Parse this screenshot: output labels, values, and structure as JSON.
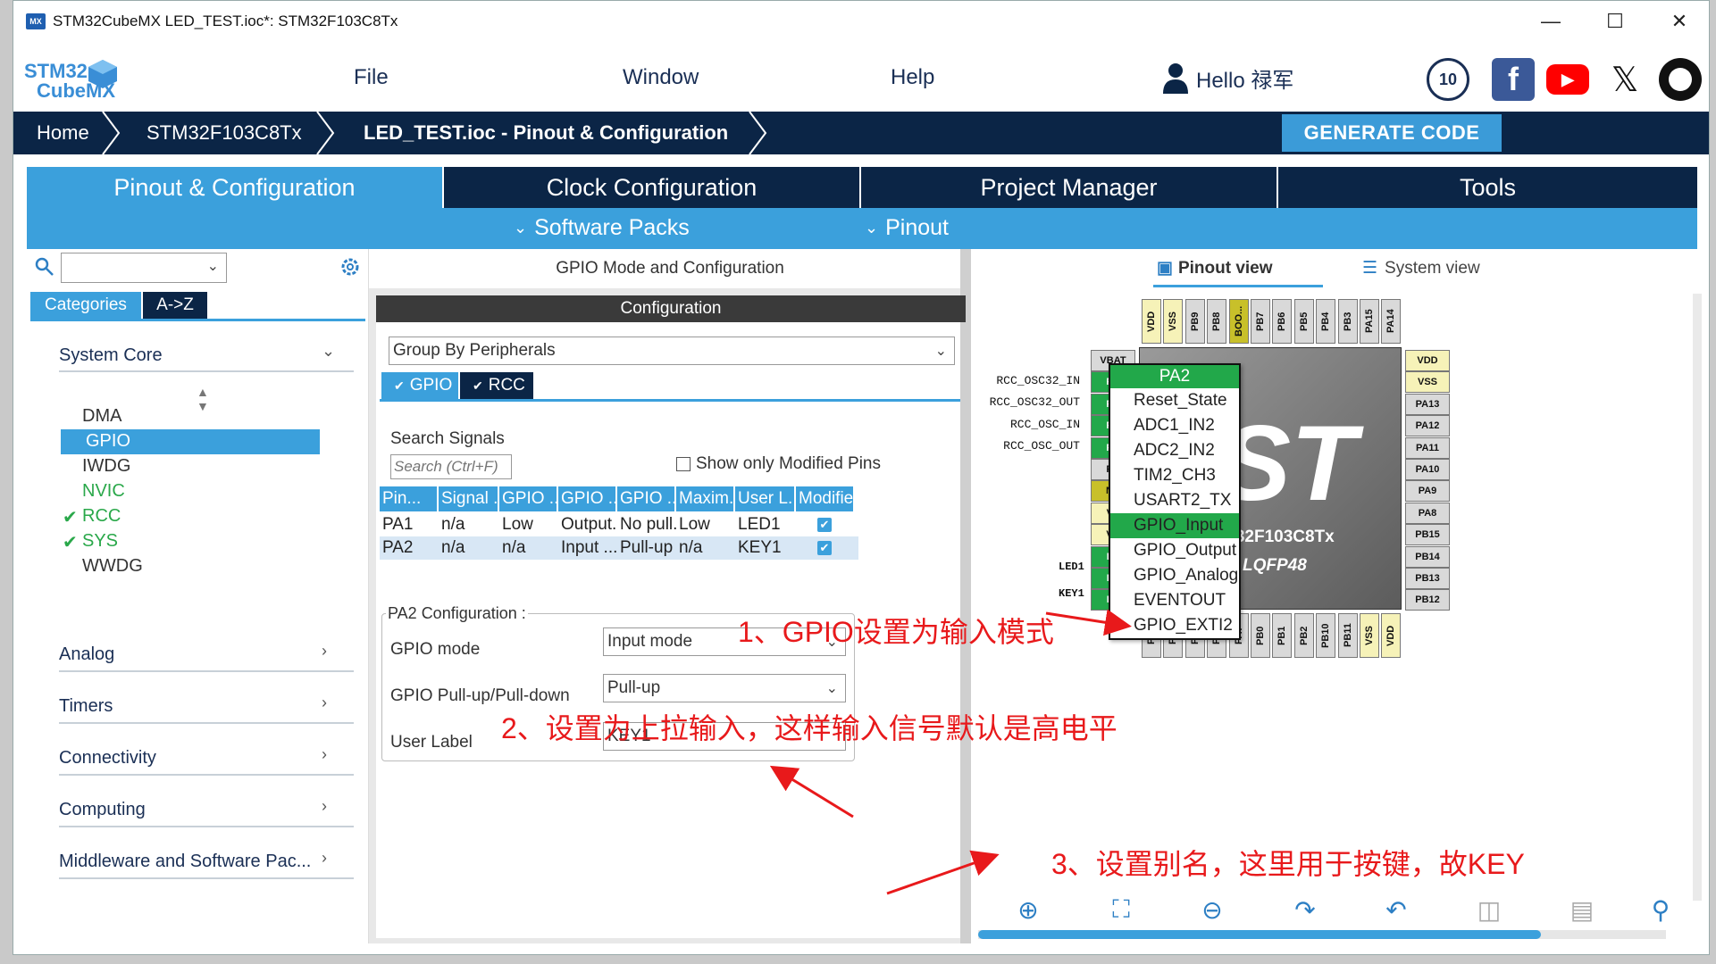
{
  "window": {
    "title": "STM32CubeMX LED_TEST.ioc*: STM32F103C8Tx",
    "app_icon": "MX"
  },
  "logo": {
    "line1": "STM32",
    "line2": "CubeMX"
  },
  "menu": {
    "file": "File",
    "window": "Window",
    "help": "Help"
  },
  "user": {
    "greeting": "Hello 禄军"
  },
  "social": {
    "badge": "10"
  },
  "breadcrumb": {
    "home": "Home",
    "mcu": "STM32F103C8Tx",
    "page": "LED_TEST.ioc - Pinout & Configuration"
  },
  "generate_label": "GENERATE CODE",
  "tabs": [
    "Pinout & Configuration",
    "Clock Configuration",
    "Project Manager",
    "Tools"
  ],
  "subtabs": {
    "software_packs": "Software Packs",
    "pinout": "Pinout"
  },
  "left": {
    "cat_tab": "Categories",
    "az_tab": "A->Z",
    "system_core": "System Core",
    "core_items": [
      {
        "label": "DMA",
        "checked": false,
        "selected": false,
        "color": "#333333"
      },
      {
        "label": "GPIO",
        "checked": false,
        "selected": true,
        "color": "#ffffff"
      },
      {
        "label": "IWDG",
        "checked": false,
        "selected": false,
        "color": "#333333"
      },
      {
        "label": "NVIC",
        "checked": false,
        "selected": false,
        "color": "#2aa84a"
      },
      {
        "label": "RCC",
        "checked": true,
        "selected": false,
        "color": "#2aa84a"
      },
      {
        "label": "SYS",
        "checked": true,
        "selected": false,
        "color": "#2aa84a"
      },
      {
        "label": "WWDG",
        "checked": false,
        "selected": false,
        "color": "#333333"
      }
    ],
    "groups": [
      "Analog",
      "Timers",
      "Connectivity",
      "Computing",
      "Middleware and Software Pac..."
    ]
  },
  "mid": {
    "header": "GPIO Mode and Configuration",
    "config_title": "Configuration",
    "group_by": "Group By Peripherals",
    "mode_tabs": [
      "GPIO",
      "RCC"
    ],
    "search_label": "Search Signals",
    "search_placeholder": "Search (Ctrl+F)",
    "show_modified": "Show only Modified Pins",
    "columns": [
      "Pin...",
      "Signal ...",
      "GPIO ...",
      "GPIO ...",
      "GPIO ...",
      "Maxim...",
      "User L...",
      "Modified"
    ],
    "rows": [
      [
        "PA1",
        "n/a",
        "Low",
        "Output...",
        "No pull...",
        "Low",
        "LED1"
      ],
      [
        "PA2",
        "n/a",
        "n/a",
        "Input ...",
        "Pull-up",
        "n/a",
        "KEY1"
      ]
    ],
    "pa2_title": "PA2 Configuration :",
    "gpio_mode_label": "GPIO mode",
    "gpio_mode_value": "Input mode",
    "pull_label": "GPIO Pull-up/Pull-down",
    "pull_value": "Pull-up",
    "user_label_label": "User Label",
    "user_label_value": "KEY1"
  },
  "right": {
    "pinout_view": "Pinout view",
    "system_view": "System view",
    "chip_name": "M32F103C8Tx",
    "package": "LQFP48",
    "top_pins": [
      "VDD",
      "VSS",
      "PB9",
      "PB8",
      "BOO...",
      "PB7",
      "PB6",
      "PB5",
      "PB4",
      "PB3",
      "PA15",
      "PA14"
    ],
    "bottom_pins": [
      "PA3",
      "PA4",
      "PA5",
      "PA6",
      "PA7",
      "PB0",
      "PB1",
      "PB2",
      "PB10",
      "PB11",
      "VSS",
      "VDD"
    ],
    "right_pins": [
      "VDD",
      "VSS",
      "PA13",
      "PA12",
      "PA11",
      "PA10",
      "PA9",
      "PA8",
      "PB15",
      "PB14",
      "PB13",
      "PB12"
    ],
    "left_pins": [
      "VBAT",
      "PC",
      "PC",
      "PC",
      "PD",
      "PD",
      "NR",
      "VS",
      "VD",
      "PA",
      "PA",
      "PA"
    ],
    "left_signals": [
      "RCC_OSC32_IN",
      "RCC_OSC32_OUT",
      "RCC_OSC_IN",
      "RCC_OSC_OUT"
    ],
    "led_label": "LED1",
    "key_label": "KEY1",
    "popup_title": "PA2",
    "popup_items": [
      "Reset_State",
      "ADC1_IN2",
      "ADC2_IN2",
      "TIM2_CH3",
      "USART2_TX",
      "GPIO_Input",
      "GPIO_Output",
      "GPIO_Analog",
      "EVENTOUT",
      "GPIO_EXTI2"
    ]
  },
  "annotations": {
    "a1": "1、GPIO设置为输入模式",
    "a2": "2、设置为上拉输入，这样输入信号默认是高电平",
    "a3": "3、设置别名，这里用于按键，故KEY"
  },
  "colors": {
    "navy": "#0b2546",
    "accent": "#3ba0dc",
    "green": "#22a84a",
    "annotation": "#e8191b"
  }
}
